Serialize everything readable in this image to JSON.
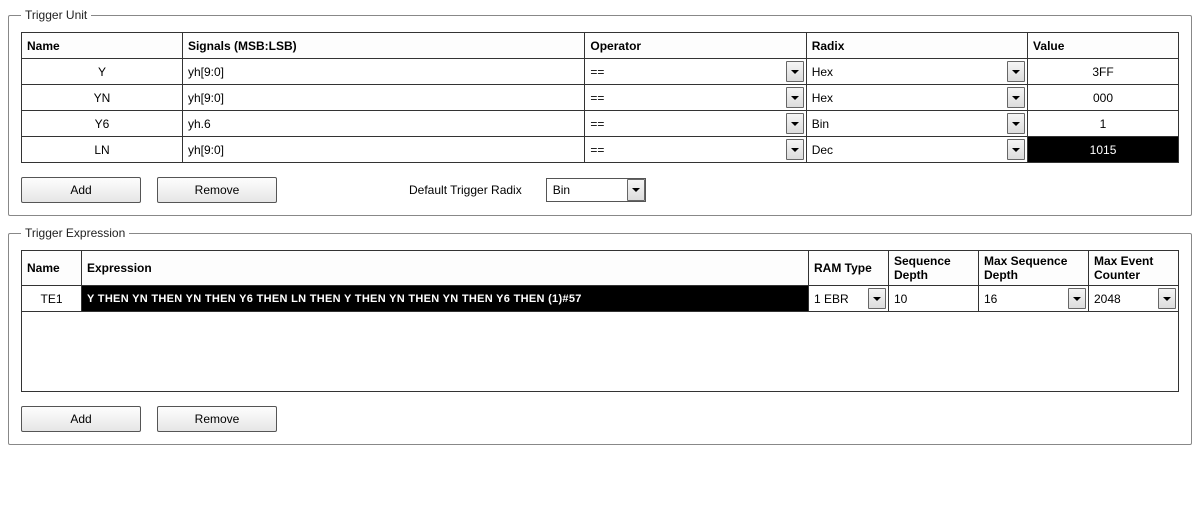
{
  "trigger_unit": {
    "legend": "Trigger Unit",
    "headers": {
      "name": "Name",
      "signals": "Signals (MSB:LSB)",
      "operator": "Operator",
      "radix": "Radix",
      "value": "Value"
    },
    "rows": [
      {
        "name": "Y",
        "signals": "yh[9:0]",
        "operator": "==",
        "radix": "Hex",
        "value": "3FF"
      },
      {
        "name": "YN",
        "signals": "yh[9:0]",
        "operator": "==",
        "radix": "Hex",
        "value": "000"
      },
      {
        "name": "Y6",
        "signals": "yh.6",
        "operator": "==",
        "radix": "Bin",
        "value": "1"
      },
      {
        "name": "LN",
        "signals": "yh[9:0]",
        "operator": "==",
        "radix": "Dec",
        "value": "1015"
      }
    ],
    "add_label": "Add",
    "remove_label": "Remove",
    "default_radix_label": "Default Trigger Radix",
    "default_radix_value": "Bin"
  },
  "trigger_expression": {
    "legend": "Trigger Expression",
    "headers": {
      "name": "Name",
      "expression": "Expression",
      "ram_type": "RAM Type",
      "seq_depth": "Sequence Depth",
      "max_seq_depth": "Max Sequence Depth",
      "max_event_counter": "Max Event Counter"
    },
    "rows": [
      {
        "name": "TE1",
        "expression": "Y THEN YN THEN YN THEN Y6 THEN LN THEN Y THEN YN THEN YN THEN Y6 THEN (1)#57",
        "ram_type": "1 EBR",
        "seq_depth": "10",
        "max_seq_depth": "16",
        "max_event_counter": "2048"
      }
    ],
    "add_label": "Add",
    "remove_label": "Remove"
  }
}
